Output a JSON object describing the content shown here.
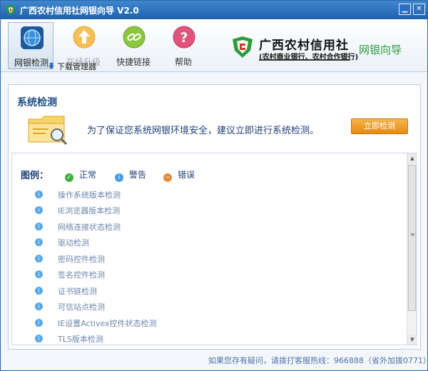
{
  "window": {
    "title": "广西农村信用社网银向导 V2.0",
    "minimize_glyph": "▁",
    "close_glyph": "✕"
  },
  "toolbar": {
    "items": [
      {
        "label": "网银检测",
        "icon": "globe-icon",
        "active": true
      },
      {
        "label": "在线升级",
        "icon": "upload-icon",
        "active": false
      },
      {
        "label": "快捷链接",
        "icon": "link-icon",
        "active": false
      },
      {
        "label": "帮助",
        "icon": "help-icon",
        "active": false
      }
    ],
    "download_manager": "下载管理器"
  },
  "brand": {
    "name": "广西农村信用社",
    "subtitle": "(农村商业银行、农村合作银行)",
    "guide": "网银向导"
  },
  "panel": {
    "title": "系统检测",
    "notice": "为了保证您系统网银环境安全，建议立即进行系统检测。",
    "check_button": "立即检测"
  },
  "legend": {
    "title": "图例：",
    "items": [
      {
        "label": "正常",
        "status": "ok",
        "color": "#3caf3a"
      },
      {
        "label": "警告",
        "status": "warn",
        "color": "#4a9be0"
      },
      {
        "label": "错误",
        "status": "error",
        "color": "#e4893a"
      }
    ]
  },
  "checks": [
    "操作系统版本检测",
    "IE浏览器版本检测",
    "网络连接状态检测",
    "驱动检测",
    "密码控件检测",
    "签名控件检测",
    "证书链检测",
    "可信站点检测",
    "IE设置Activex控件状态检测",
    "TLS版本检测"
  ],
  "footer": {
    "hotline": "如果您存有疑问，请拨打客服热线：966888（省外加拨0771）。"
  },
  "colors": {
    "titlebar": "#1f62ad",
    "accent_orange": "#e58a12",
    "brand_green": "#2c9b3c"
  }
}
